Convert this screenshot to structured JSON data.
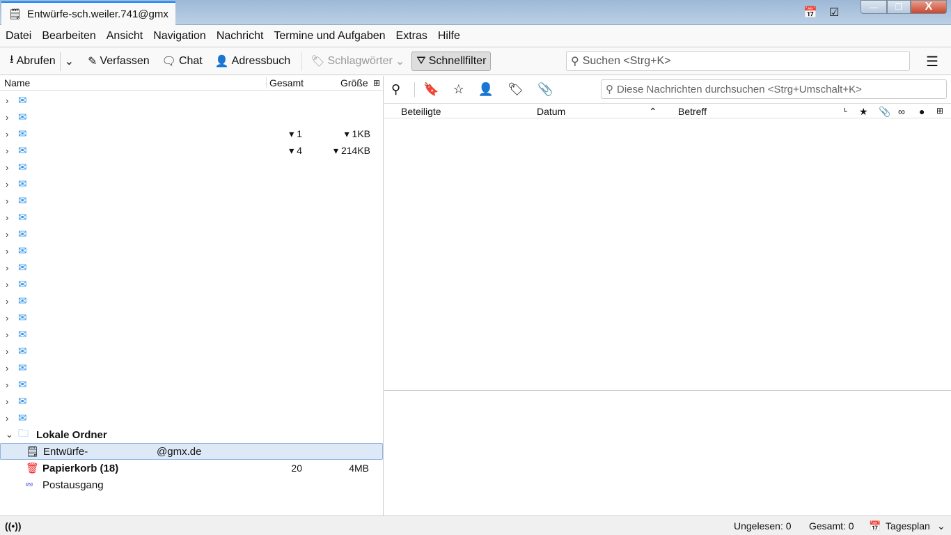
{
  "window": {
    "tab_title": "Entwürfe-sch.weiler.741@gmx",
    "minimize": "—",
    "maximize": "❐",
    "close": "X"
  },
  "menu": [
    "Datei",
    "Bearbeiten",
    "Ansicht",
    "Navigation",
    "Nachricht",
    "Termine und Aufgaben",
    "Extras",
    "Hilfe"
  ],
  "toolbar": {
    "get": "Abrufen",
    "compose": "Verfassen",
    "chat": "Chat",
    "addressbook": "Adressbuch",
    "tags": "Schlagwörter",
    "quickfilter": "Schnellfilter",
    "search_placeholder": "Suchen <Strg+K>"
  },
  "folder_header": {
    "name": "Name",
    "total": "Gesamt",
    "size": "Größe"
  },
  "accounts": [
    {},
    {},
    {
      "total": "▾ 1",
      "size": "▾ 1KB"
    },
    {
      "total": "▾ 4",
      "size": "▾ 214KB"
    },
    {},
    {},
    {},
    {},
    {},
    {},
    {},
    {},
    {},
    {},
    {},
    {},
    {},
    {},
    {},
    {}
  ],
  "local": {
    "label": "Lokale Ordner",
    "drafts_prefix": "Entwürfe-",
    "drafts_suffix": "@gmx.de",
    "trash": "Papierkorb (18)",
    "trash_total": "20",
    "trash_size": "4MB",
    "outbox": "Postausgang"
  },
  "messages": {
    "search_placeholder": "Diese Nachrichten durchsuchen <Strg+Umschalt+K>",
    "col_participants": "Beteiligte",
    "col_date": "Datum",
    "col_subject": "Betreff"
  },
  "status": {
    "unread": "Ungelesen: 0",
    "total": "Gesamt: 0",
    "today": "Tagesplan"
  }
}
